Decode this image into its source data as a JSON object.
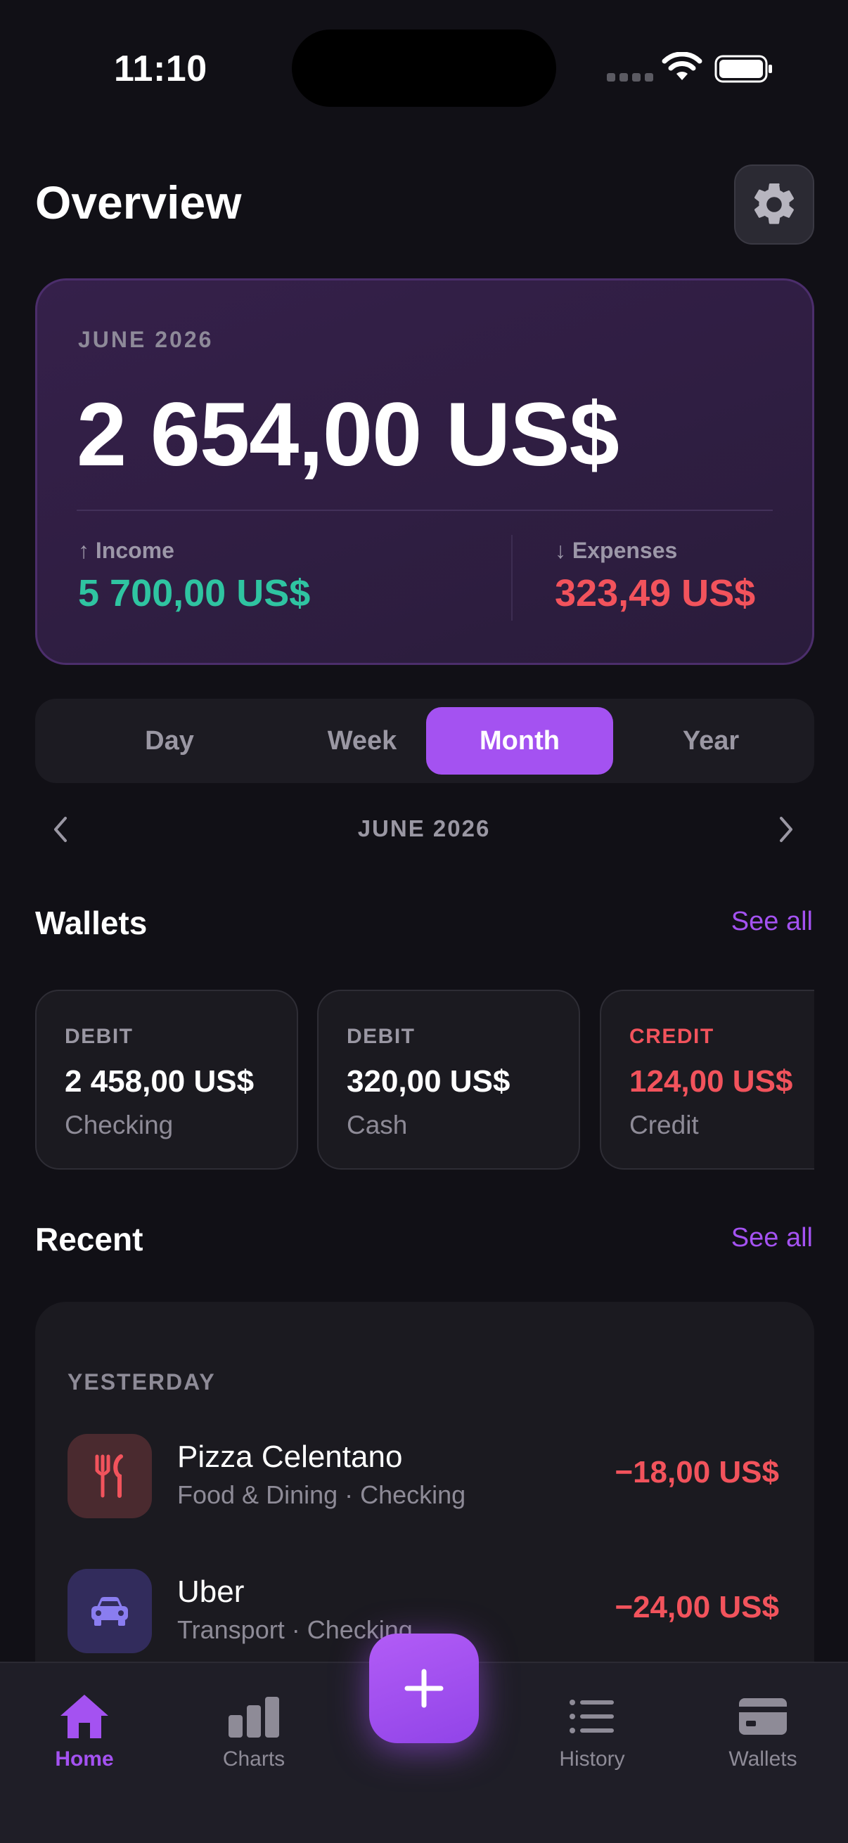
{
  "status_bar": {
    "time": "11:10"
  },
  "header": {
    "title": "Overview"
  },
  "balance_card": {
    "period": "JUNE 2026",
    "balance": "2 654,00 US$",
    "income_label": "↑ Income",
    "income_value": "5 700,00 US$",
    "expenses_label": "↓ Expenses",
    "expenses_value": "323,49 US$"
  },
  "segments": {
    "items": [
      "Day",
      "Week",
      "Month",
      "Year"
    ],
    "active": "Month"
  },
  "period_nav": {
    "label": "JUNE 2026"
  },
  "wallets": {
    "title": "Wallets",
    "see_all": "See all",
    "items": [
      {
        "type": "DEBIT",
        "amount": "2 458,00 US$",
        "name": "Checking"
      },
      {
        "type": "DEBIT",
        "amount": "320,00 US$",
        "name": "Cash"
      },
      {
        "type": "CREDIT",
        "amount": "124,00 US$",
        "name": "Credit"
      }
    ]
  },
  "recent": {
    "title": "Recent",
    "see_all": "See all",
    "group_label": "YESTERDAY",
    "items": [
      {
        "title": "Pizza Celentano",
        "subtitle": "Food & Dining · Checking",
        "amount": "−18,00 US$",
        "icon": "fork-knife-icon"
      },
      {
        "title": "Uber",
        "subtitle": "Transport · Checking",
        "amount": "−24,00 US$",
        "icon": "car-icon"
      }
    ]
  },
  "tab_bar": {
    "items": [
      {
        "label": "Home",
        "icon": "home-icon",
        "active": true
      },
      {
        "label": "Charts",
        "icon": "bar-chart-icon",
        "active": false
      },
      {
        "label": "History",
        "icon": "list-icon",
        "active": false
      },
      {
        "label": "Wallets",
        "icon": "wallet-icon",
        "active": false
      }
    ],
    "fab_icon": "plus-icon"
  },
  "colors": {
    "background": "#111016",
    "accent": "#a452f1",
    "income": "#2fc4a1",
    "expense": "#f2535c"
  }
}
